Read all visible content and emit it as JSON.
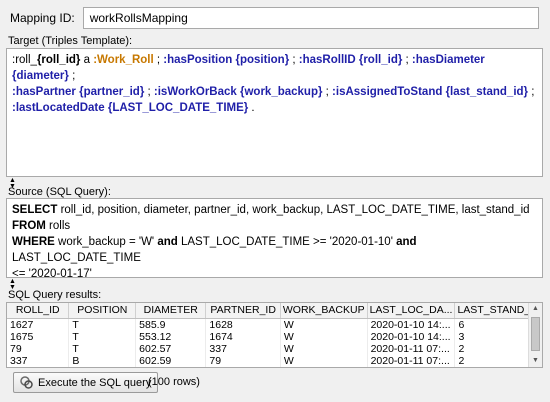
{
  "mapping": {
    "id_label": "Mapping ID:",
    "id_value": "workRollsMapping"
  },
  "target": {
    "label": "Target (Triples Template):",
    "tokens": [
      [
        ":roll_",
        "s"
      ],
      [
        "{roll_id}",
        "b"
      ],
      [
        " a ",
        "s"
      ],
      [
        ":Work_Roll",
        "o"
      ],
      [
        " ; ",
        "s"
      ],
      [
        ":hasPosition",
        "u"
      ],
      [
        " ",
        "s"
      ],
      [
        "{position}",
        "u"
      ],
      [
        " ; ",
        "s"
      ],
      [
        ":hasRollID",
        "u"
      ],
      [
        " ",
        "s"
      ],
      [
        "{roll_id}",
        "u"
      ],
      [
        " ; ",
        "s"
      ],
      [
        ":hasDiameter",
        "u"
      ],
      [
        " ",
        "s"
      ],
      [
        "{diameter}",
        "u"
      ],
      [
        " ;",
        "s"
      ],
      [
        "\n",
        "n"
      ],
      [
        ":hasPartner",
        "u"
      ],
      [
        " ",
        "s"
      ],
      [
        "{partner_id}",
        "u"
      ],
      [
        " ; ",
        "s"
      ],
      [
        ":isWorkOrBack",
        "u"
      ],
      [
        " ",
        "s"
      ],
      [
        "{work_backup}",
        "u"
      ],
      [
        " ; ",
        "s"
      ],
      [
        ":isAssignedToStand",
        "u"
      ],
      [
        " ",
        "s"
      ],
      [
        "{last_stand_id}",
        "u"
      ],
      [
        " ;",
        "s"
      ],
      [
        "\n",
        "n"
      ],
      [
        ":lastLocatedDate",
        "u"
      ],
      [
        " ",
        "s"
      ],
      [
        "{LAST_LOC_DATE_TIME}",
        "u"
      ],
      [
        " .",
        "s"
      ]
    ]
  },
  "source": {
    "label": "Source (SQL Query):",
    "tokens": [
      [
        "SELECT",
        "k"
      ],
      [
        " roll_id, position, diameter, partner_id, work_backup, LAST_LOC_DATE_TIME, last_stand_id",
        "t"
      ],
      [
        "\n",
        "n"
      ],
      [
        "FROM",
        "k"
      ],
      [
        " rolls",
        "t"
      ],
      [
        "\n",
        "n"
      ],
      [
        "WHERE",
        "k"
      ],
      [
        " work_backup = 'W' ",
        "t"
      ],
      [
        "and",
        "k"
      ],
      [
        "  LAST_LOC_DATE_TIME >= '2020-01-10' ",
        "t"
      ],
      [
        "and",
        "k"
      ],
      [
        " LAST_LOC_DATE_TIME",
        "t"
      ],
      [
        "\n",
        "n"
      ],
      [
        "<= '2020-01-17'",
        "t"
      ]
    ]
  },
  "results": {
    "label": "SQL Query results:",
    "columns": [
      "ROLL_ID",
      "POSITION",
      "DIAMETER",
      "PARTNER_ID",
      "WORK_BACKUP",
      "LAST_LOC_DA...",
      "LAST_STAND_..."
    ],
    "rows": [
      [
        "1627",
        "T",
        "585.9",
        "1628",
        "W",
        "2020-01-10 14:...",
        "6"
      ],
      [
        "1675",
        "T",
        "553.12",
        "1674",
        "W",
        "2020-01-10 14:...",
        "3"
      ],
      [
        "79",
        "T",
        "602.57",
        "337",
        "W",
        "2020-01-11 07:...",
        "2"
      ],
      [
        "337",
        "B",
        "602.59",
        "79",
        "W",
        "2020-01-11 07:...",
        "2"
      ]
    ]
  },
  "actions": {
    "execute_label": "Execute the SQL query",
    "row_count": "(100 rows)"
  },
  "colors": {
    "prop_blue": "#1f1fa8",
    "class_orange": "#c77800"
  }
}
